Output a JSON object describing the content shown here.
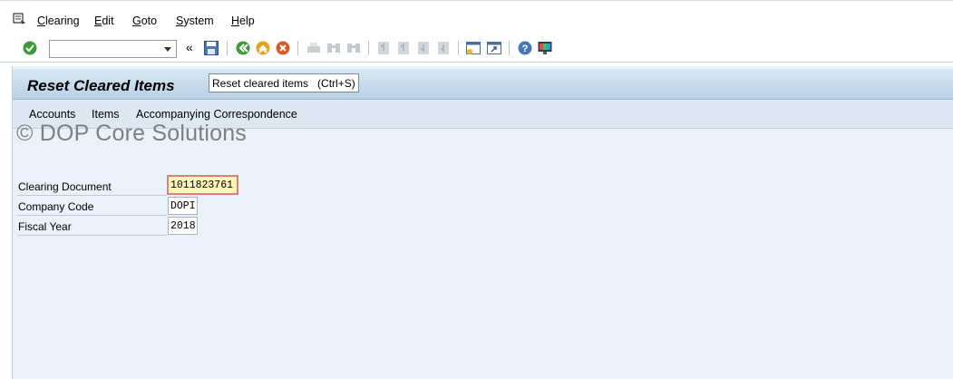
{
  "menu": {
    "items": [
      {
        "pre": "",
        "u": "C",
        "post": "learing"
      },
      {
        "pre": "",
        "u": "E",
        "post": "dit"
      },
      {
        "pre": "",
        "u": "G",
        "post": "oto"
      },
      {
        "pre": "",
        "u": "S",
        "post": "ystem"
      },
      {
        "pre": "",
        "u": "H",
        "post": "elp"
      }
    ]
  },
  "toolbar": {
    "command_field_value": "",
    "icons": [
      "enter-icon",
      "save-icon",
      "back-icon",
      "exit-icon",
      "cancel-icon",
      "print-icon",
      "find-icon",
      "find-next-icon",
      "first-page-icon",
      "previous-page-icon",
      "next-page-icon",
      "last-page-icon",
      "create-session-icon",
      "shortcut-icon",
      "help-icon",
      "customize-layout-icon"
    ]
  },
  "screen": {
    "title": "Reset Cleared Items",
    "tooltip": "Reset cleared items   (Ctrl+S)"
  },
  "appbar": {
    "items": [
      "Accounts",
      "Items",
      "Accompanying Correspondence"
    ]
  },
  "watermark": "© DOP Core Solutions",
  "fields": {
    "clearing_document": {
      "label": "Clearing Document",
      "value": "1011823761"
    },
    "company_code": {
      "label": "Company Code",
      "value": "DOPI"
    },
    "fiscal_year": {
      "label": "Fiscal Year",
      "value": "2018"
    }
  },
  "colors": {
    "title_gradient_top": "#d9e8f5",
    "title_gradient_bottom": "#b9d0e6",
    "frame_bg": "#eaf1f8",
    "focused_field_bg": "#fff7b8"
  }
}
